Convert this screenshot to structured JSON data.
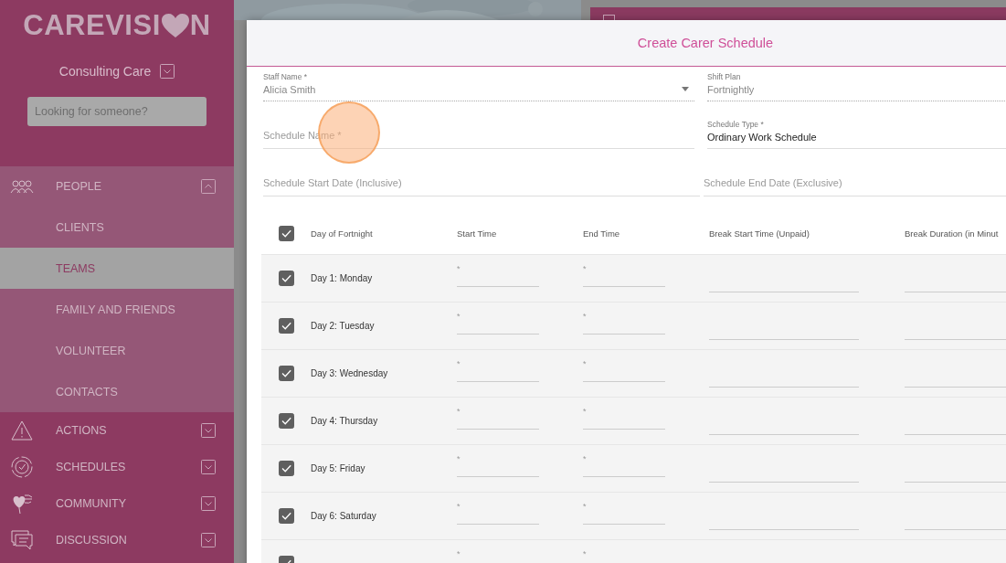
{
  "brand": {
    "logo_start": "CAREVISI",
    "logo_end": "N"
  },
  "org": {
    "name": "Consulting Care"
  },
  "search": {
    "placeholder": "Looking for someone?"
  },
  "nav": [
    {
      "label": "PEOPLE",
      "kind": "people",
      "expanded": true,
      "children": [
        {
          "label": "CLIENTS",
          "selected": false
        },
        {
          "label": "TEAMS",
          "selected": true
        },
        {
          "label": "FAMILY AND FRIENDS",
          "selected": false
        },
        {
          "label": "VOLUNTEER",
          "selected": false
        },
        {
          "label": "CONTACTS",
          "selected": false
        }
      ]
    },
    {
      "label": "ACTIONS",
      "kind": "warning",
      "expanded": false
    },
    {
      "label": "SCHEDULES",
      "kind": "clock",
      "expanded": false
    },
    {
      "label": "COMMUNITY",
      "kind": "hearts",
      "expanded": false
    },
    {
      "label": "DISCUSSION",
      "kind": "chat",
      "expanded": false
    }
  ],
  "dialog": {
    "title": "Create Carer Schedule",
    "fields": [
      [
        {
          "kind": "select",
          "label": "Staff Name *",
          "value": "Alicia Smith",
          "disabled": true
        },
        {
          "kind": "readonly",
          "label": "Shift Plan",
          "value": "Fortnightly",
          "disabled": true
        }
      ],
      [
        {
          "kind": "input",
          "placeholder": "Schedule Name *"
        },
        {
          "kind": "input",
          "label": "Schedule Type *",
          "value": "Ordinary Work Schedule"
        }
      ],
      [
        {
          "kind": "input",
          "placeholder": "Schedule Start Date (Inclusive)"
        },
        {
          "kind": "input",
          "placeholder": "Schedule End Date (Exclusive)"
        }
      ]
    ],
    "table": {
      "all_checked": true,
      "columns": [
        "Day of Fortnight",
        "Start Time",
        "End Time",
        "Break Start Time (Unpaid)",
        "Break Duration (in Minut"
      ],
      "rows": [
        {
          "day": "Day 1: Monday",
          "checked": true,
          "start_label": "*",
          "end_label": "*"
        },
        {
          "day": "Day 2: Tuesday",
          "checked": true,
          "start_label": "*",
          "end_label": "*"
        },
        {
          "day": "Day 3: Wednesday",
          "checked": true,
          "start_label": "*",
          "end_label": "*"
        },
        {
          "day": "Day 4: Thursday",
          "checked": true,
          "start_label": "*",
          "end_label": "*"
        },
        {
          "day": "Day 5: Friday",
          "checked": true,
          "start_label": "*",
          "end_label": "*"
        },
        {
          "day": "Day 6: Saturday",
          "checked": true,
          "start_label": "*",
          "end_label": "*"
        },
        {
          "checked": true,
          "start_label": "*",
          "end_label": "*"
        }
      ]
    }
  }
}
